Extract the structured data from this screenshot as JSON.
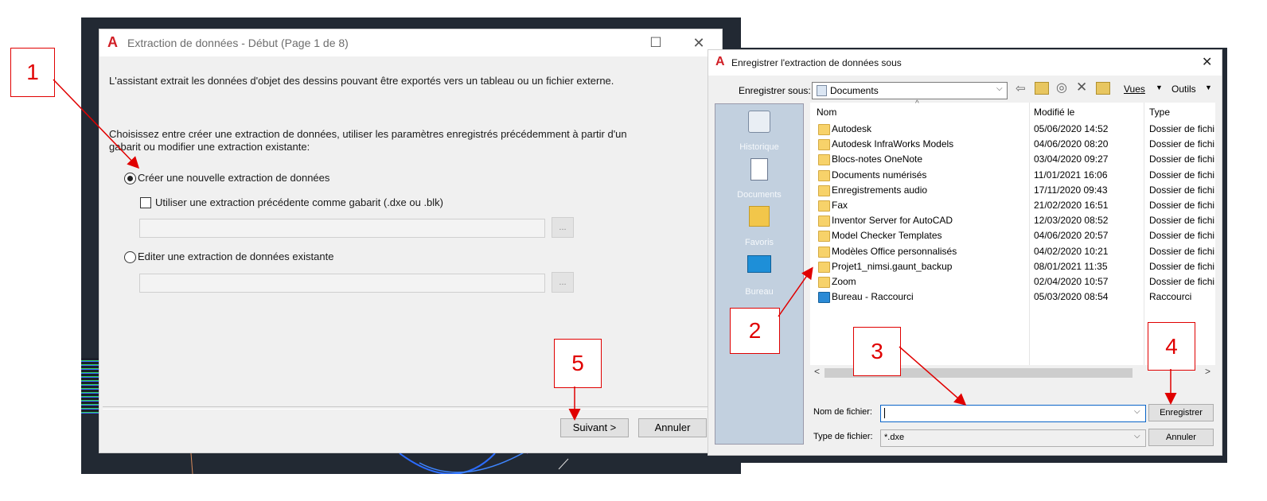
{
  "dialog1": {
    "title": "Extraction de données - Début (Page 1 de 8)",
    "logo": "A",
    "description": "L'assistant extrait les données d'objet des dessins pouvant être exportés vers un tableau ou un fichier externe.",
    "instruction_line1": "Choisissez entre créer une extraction de données, utiliser les paramètres enregistrés précédemment à partir d'un",
    "instruction_line2": "gabarit ou modifier une extraction existante:",
    "option_create": "Créer une nouvelle extraction de données",
    "option_template": "Utiliser une extraction précédente comme gabarit (.dxe ou .blk)",
    "option_edit": "Editer une extraction de données existante",
    "browse_label": "...",
    "next_button": "Suivant >",
    "cancel_button": "Annuler",
    "minimize": "",
    "maximize": "☐",
    "close": "✕"
  },
  "dialog2": {
    "title": "Enregistrer l'extraction de données sous",
    "logo": "A",
    "close": "✕",
    "save_in_label": "Enregistrer sous:",
    "save_in_value": "Documents",
    "views_label": "Vues",
    "tools_label": "Outils",
    "places": [
      {
        "label": "Historique"
      },
      {
        "label": "Documents"
      },
      {
        "label": "Favoris"
      },
      {
        "label": "Bureau"
      }
    ],
    "columns": {
      "name": "Nom",
      "modified": "Modifié le",
      "type": "Type"
    },
    "files": [
      {
        "name": "Autodesk",
        "modified": "05/06/2020 14:52",
        "type": "Dossier de fichi"
      },
      {
        "name": "Autodesk InfraWorks Models",
        "modified": "04/06/2020 08:20",
        "type": "Dossier de fichi"
      },
      {
        "name": "Blocs-notes OneNote",
        "modified": "03/04/2020 09:27",
        "type": "Dossier de fichi"
      },
      {
        "name": "Documents numérisés",
        "modified": "11/01/2021 16:06",
        "type": "Dossier de fichi"
      },
      {
        "name": "Enregistrements audio",
        "modified": "17/11/2020 09:43",
        "type": "Dossier de fichi"
      },
      {
        "name": "Fax",
        "modified": "21/02/2020 16:51",
        "type": "Dossier de fichi"
      },
      {
        "name": "Inventor Server for AutoCAD",
        "modified": "12/03/2020 08:52",
        "type": "Dossier de fichi"
      },
      {
        "name": "Model Checker Templates",
        "modified": "04/06/2020 20:57",
        "type": "Dossier de fichi"
      },
      {
        "name": "Modèles Office personnalisés",
        "modified": "04/02/2020 10:21",
        "type": "Dossier de fichi"
      },
      {
        "name": "Projet1_nimsi.gaunt_backup",
        "modified": "08/01/2021 11:35",
        "type": "Dossier de fichi"
      },
      {
        "name": "Zoom",
        "modified": "02/04/2020 10:57",
        "type": "Dossier de fichi"
      },
      {
        "name": "Bureau - Raccourci",
        "modified": "05/03/2020 08:54",
        "type": "Raccourci"
      }
    ],
    "filename_label": "Nom de fichier:",
    "filename_value": "",
    "filetype_label": "Type de fichier:",
    "filetype_value": "*.dxe",
    "save_button": "Enregistrer",
    "cancel_button": "Annuler"
  },
  "annotations": [
    "1",
    "2",
    "3",
    "4",
    "5"
  ],
  "colors": {
    "annotation": "#e00000",
    "autocad_red": "#d11f26",
    "cad_background": "#222933"
  }
}
